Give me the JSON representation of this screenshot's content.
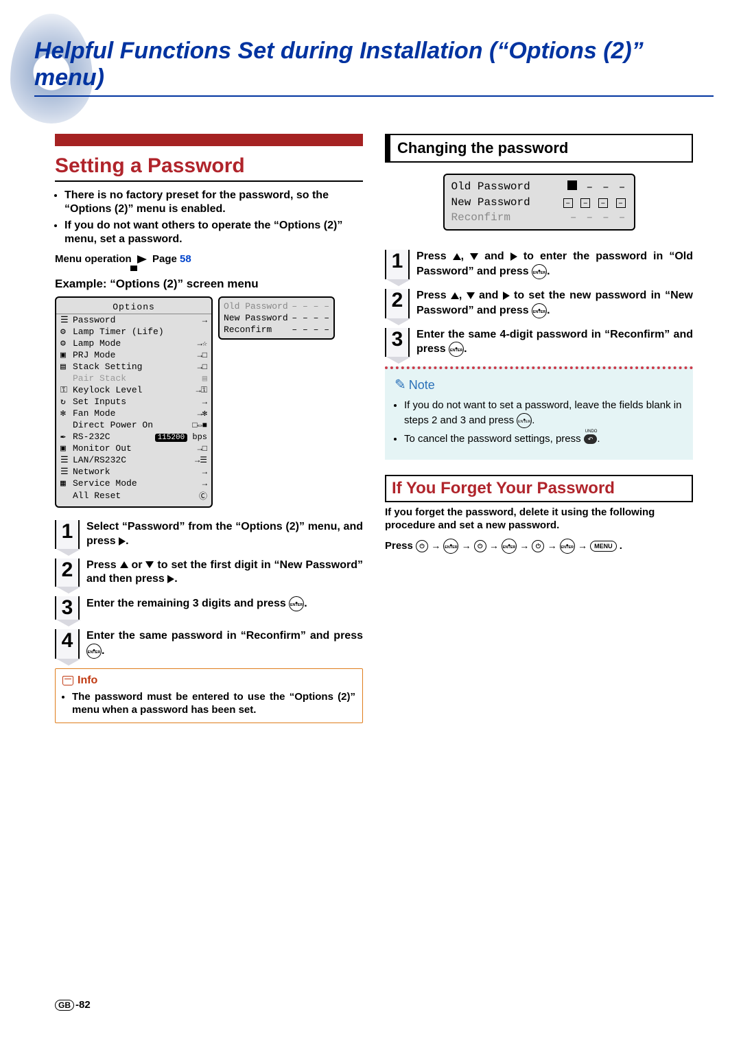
{
  "page_title": "Helpful Functions Set during Installation (“Options (2)” menu)",
  "left": {
    "heading": "Setting a Password",
    "bullets": [
      "There is no factory preset for the password, so the “Options (2)” menu is enabled.",
      "If you do not want others to operate the “Options (2)” menu, set a password."
    ],
    "menu_op_label": "Menu operation",
    "menu_op_page_label": "Page",
    "menu_op_page": "58",
    "example_heading": "Example: “Options (2)” screen menu",
    "osd_title": "Options",
    "osd_rows": [
      {
        "icon": "☰",
        "label": "Password",
        "right": "→"
      },
      {
        "icon": "⚙",
        "label": "Lamp Timer (Life)",
        "right": ""
      },
      {
        "icon": "⚙",
        "label": "Lamp Mode",
        "right": "→☆"
      },
      {
        "icon": "▣",
        "label": "PRJ Mode",
        "right": "→□"
      },
      {
        "icon": "▤",
        "label": "Stack Setting",
        "right": "→□"
      },
      {
        "icon": "",
        "label": "Pair Stack",
        "right": "▤"
      },
      {
        "icon": "⚿",
        "label": "Keylock Level",
        "right": "→⚿"
      },
      {
        "icon": "↻",
        "label": "Set Inputs",
        "right": "→"
      },
      {
        "icon": "✻",
        "label": "Fan Mode",
        "right": "→✻"
      },
      {
        "icon": "",
        "label": "Direct Power On",
        "right": "□⇔■"
      },
      {
        "icon": "✒",
        "label": "RS-232C",
        "right": "115200 bps"
      },
      {
        "icon": "▣",
        "label": "Monitor Out",
        "right": "→□"
      },
      {
        "icon": "☰",
        "label": "LAN/RS232C",
        "right": "→☰"
      },
      {
        "icon": "☰",
        "label": "Network",
        "right": "→"
      },
      {
        "icon": "▦",
        "label": "Service Mode",
        "right": "→"
      },
      {
        "icon": "",
        "label": "All Reset",
        "right": "Ⓒ"
      }
    ],
    "osd_pw_rows": [
      {
        "label": "Old Password",
        "val": "– – – –"
      },
      {
        "label": "New Password",
        "val": "– – – –"
      },
      {
        "label": "Reconfirm",
        "val": "– – – –"
      }
    ],
    "steps": [
      "Select “Password” from the “Options (2)” menu, and press ▶.",
      "Press ▲ or ▼ to set the first digit in “New Password” and then press ▶.",
      "Enter the remaining 3 digits and press (ENTER).",
      "Enter the same password in “Reconfirm” and press (ENTER)."
    ],
    "info_label": "Info",
    "info_text": "The password must be entered to use the “Options (2)” menu when a password has been set."
  },
  "right": {
    "sub_heading": "Changing the password",
    "pw_rows": [
      {
        "label": "Old Password",
        "val": [
          "■",
          "–",
          "–",
          "–"
        ]
      },
      {
        "label": "New Password",
        "val": [
          "–",
          "–",
          "–",
          "–"
        ]
      },
      {
        "label": "Reconfirm",
        "val": [
          "–",
          "–",
          "–",
          "–"
        ]
      }
    ],
    "steps": [
      "Press ▲, ▼ and ▶ to enter the password in “Old Password” and press (ENTER).",
      "Press ▲, ▼ and ▶ to set the new password in “New Password” and press (ENTER).",
      "Enter the same 4-digit password in “Reconfirm” and press (ENTER)."
    ],
    "note_label": "Note",
    "note_items": [
      "If you do not want to set a password, leave the fields blank in steps 2 and 3 and press (ENTER).",
      "To cancel the password settings, press (UNDO)."
    ],
    "forget_heading": "If You Forget Your Password",
    "forget_text": "If you forget the password, delete it using the following procedure and set a new password.",
    "seq_label": "Press",
    "seq": [
      "Ⓘ",
      "→",
      "⊛",
      "→",
      "Ⓘ",
      "→",
      "⊛",
      "→",
      "Ⓘ",
      "→",
      "⊛",
      "→",
      "MENU"
    ]
  },
  "footer": {
    "region": "GB",
    "page": "-82"
  }
}
